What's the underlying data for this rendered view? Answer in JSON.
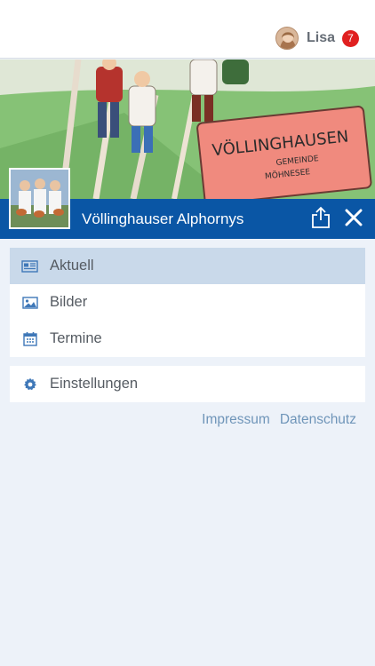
{
  "header": {
    "user_name": "Lisa",
    "notification_count": "7",
    "avatar_icon": "user-avatar"
  },
  "hero": {
    "sign_title": "VÖLLINGHAUSEN",
    "sign_line1": "GEMEINDE",
    "sign_line2": "MÖHNESEE"
  },
  "group": {
    "title": "Völlinghauser Alphornys",
    "share_icon": "share-icon",
    "close_icon": "close-icon",
    "accent_color": "#0a56a5"
  },
  "menu": {
    "items": [
      {
        "label": "Aktuell",
        "icon": "news-icon",
        "active": true
      },
      {
        "label": "Bilder",
        "icon": "image-icon",
        "active": false
      },
      {
        "label": "Termine",
        "icon": "calendar-icon",
        "active": false
      }
    ],
    "settings": {
      "label": "Einstellungen",
      "icon": "gear-icon"
    }
  },
  "footer": {
    "impressum": "Impressum",
    "datenschutz": "Datenschutz"
  },
  "colors": {
    "badge": "#e02020",
    "active_item": "#c9d9ea",
    "link": "#6f95b9",
    "background": "#edf2f9"
  }
}
